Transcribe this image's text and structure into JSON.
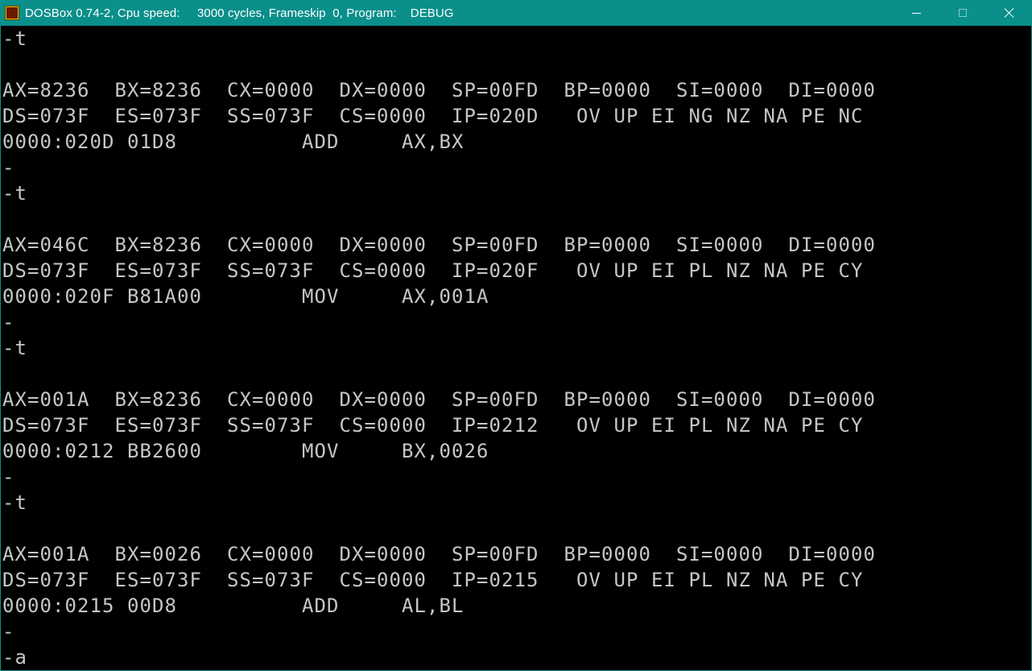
{
  "window": {
    "title": "DOSBox 0.74-2, Cpu speed:     3000 cycles, Frameskip  0, Program:    DEBUG",
    "icon": "dosbox-icon"
  },
  "console": {
    "lines": [
      "-t",
      "",
      "AX=8236  BX=8236  CX=0000  DX=0000  SP=00FD  BP=0000  SI=0000  DI=0000",
      "DS=073F  ES=073F  SS=073F  CS=0000  IP=020D   OV UP EI NG NZ NA PE NC",
      "0000:020D 01D8          ADD     AX,BX",
      "-",
      "-t",
      "",
      "AX=046C  BX=8236  CX=0000  DX=0000  SP=00FD  BP=0000  SI=0000  DI=0000",
      "DS=073F  ES=073F  SS=073F  CS=0000  IP=020F   OV UP EI PL NZ NA PE CY",
      "0000:020F B81A00        MOV     AX,001A",
      "-",
      "-t",
      "",
      "AX=001A  BX=8236  CX=0000  DX=0000  SP=00FD  BP=0000  SI=0000  DI=0000",
      "DS=073F  ES=073F  SS=073F  CS=0000  IP=0212   OV UP EI PL NZ NA PE CY",
      "0000:0212 BB2600        MOV     BX,0026",
      "-",
      "-t",
      "",
      "AX=001A  BX=0026  CX=0000  DX=0000  SP=00FD  BP=0000  SI=0000  DI=0000",
      "DS=073F  ES=073F  SS=073F  CS=0000  IP=0215   OV UP EI PL NZ NA PE CY",
      "0000:0215 00D8          ADD     AL,BL",
      "-",
      "-a"
    ]
  },
  "colors": {
    "titlebar": "#0a8f8a",
    "console_bg": "#000000",
    "console_text": "#c6c6c6"
  }
}
